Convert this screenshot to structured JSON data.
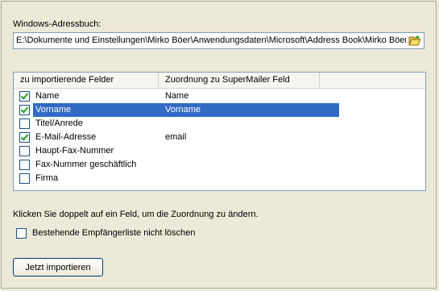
{
  "address_book": {
    "label": "Windows-Adressbuch:",
    "path": "E:\\Dokumente und Einstellungen\\Mirko Böer\\Anwendungsdaten\\Microsoft\\Address Book\\Mirko Böer.wab",
    "browse_icon": "folder-open-icon"
  },
  "list": {
    "columns": [
      "zu importierende Felder",
      "Zuordnung zu SuperMailer Feld"
    ],
    "rows": [
      {
        "field": "Name",
        "mapping": "Name",
        "checked": true,
        "selected": false
      },
      {
        "field": "Vorname",
        "mapping": "Vorname",
        "checked": true,
        "selected": true
      },
      {
        "field": "Titel/Anrede",
        "mapping": "",
        "checked": false,
        "selected": false
      },
      {
        "field": "E-Mail-Adresse",
        "mapping": "email",
        "checked": true,
        "selected": false
      },
      {
        "field": "Haupt-Fax-Nummer",
        "mapping": "",
        "checked": false,
        "selected": false
      },
      {
        "field": "Fax-Nummer geschäftlich",
        "mapping": "",
        "checked": false,
        "selected": false
      },
      {
        "field": "Firma",
        "mapping": "",
        "checked": false,
        "selected": false
      }
    ]
  },
  "hint": "Klicken Sie doppelt auf ein Feld, um die Zuordnung zu ändern.",
  "keep_list": {
    "label": "Bestehende Empfängerliste nicht löschen",
    "checked": false
  },
  "import_button": "Jetzt importieren",
  "colors": {
    "selection": "#316ac5",
    "check": "#21a121",
    "background": "#ece9d8"
  }
}
